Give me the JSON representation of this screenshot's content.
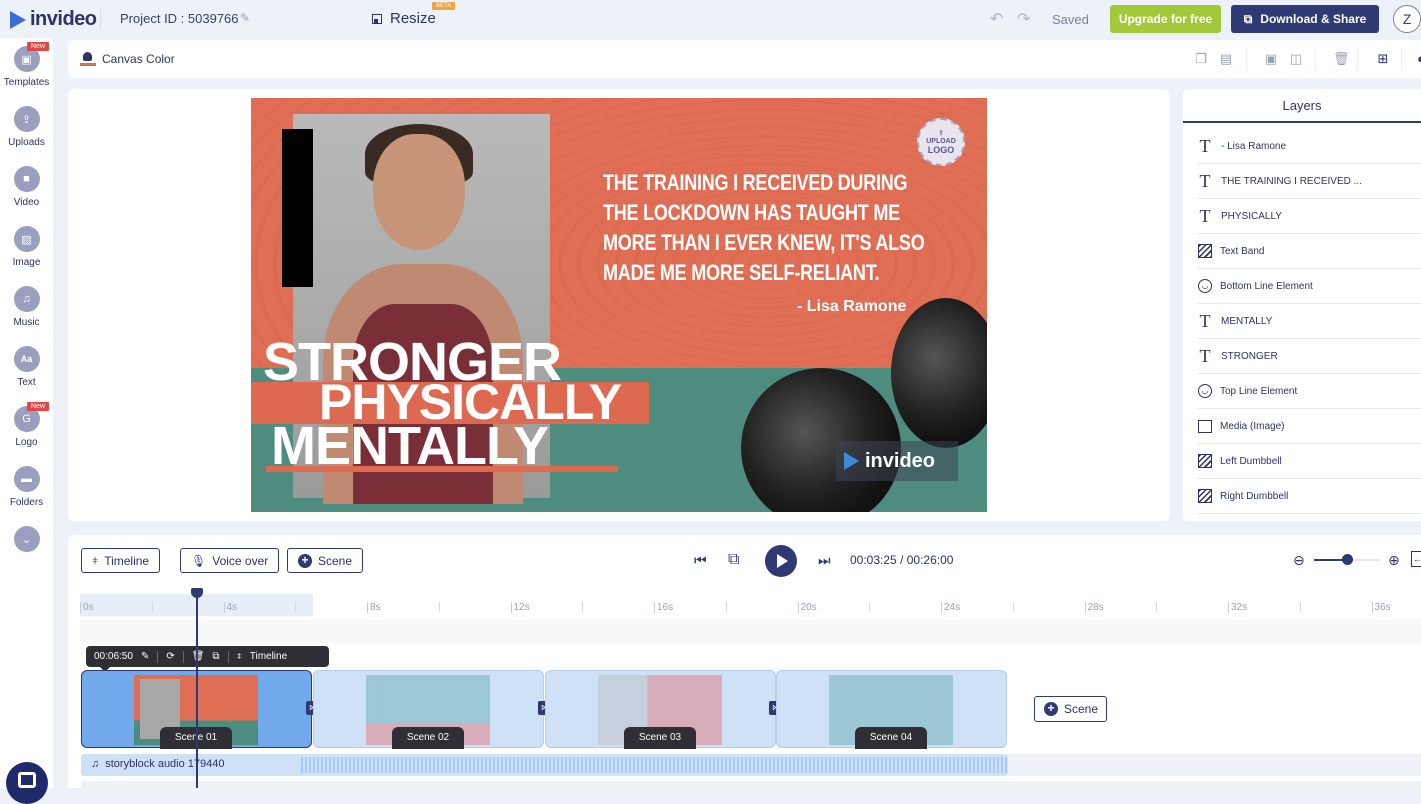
{
  "header": {
    "brand": "invideo",
    "project_id": "Project ID : 5039766",
    "resize_label": "Resize",
    "beta_badge": "BETA",
    "status": "Saved",
    "upgrade_label": "Upgrade for free",
    "download_label": "Download & Share",
    "avatar_initial": "Z"
  },
  "sidebar": {
    "items": [
      {
        "label": "Templates",
        "icon": "templates-icon",
        "badge": "New"
      },
      {
        "label": "Uploads",
        "icon": "upload-icon",
        "badge": ""
      },
      {
        "label": "Video",
        "icon": "video-icon",
        "badge": ""
      },
      {
        "label": "Image",
        "icon": "image-icon",
        "badge": ""
      },
      {
        "label": "Music",
        "icon": "music-icon",
        "badge": ""
      },
      {
        "label": "Text",
        "icon": "text-icon",
        "badge": ""
      },
      {
        "label": "Logo",
        "icon": "logo-icon",
        "badge": "New"
      },
      {
        "label": "Folders",
        "icon": "folder-icon",
        "badge": ""
      }
    ]
  },
  "canvas_toolbar": {
    "canvas_color_label": "Canvas Color",
    "canvas_color": "#e06a4a"
  },
  "design": {
    "quote_lines": [
      "THE TRAINING I RECEIVED DURING",
      "THE LOCKDOWN HAS TAUGHT ME",
      "MORE THAN I EVER KNEW, IT'S ALSO",
      "MADE ME MORE SELF-RELIANT."
    ],
    "author": "- Lisa Ramone",
    "headline_1": "STRONGER",
    "headline_2": "PHYSICALLY",
    "headline_3": "MENTALLY",
    "upload_logo_line1": "UPLOAD",
    "upload_logo_line2": "LOGO",
    "watermark": "invideo",
    "colors": {
      "primary": "#e06e55",
      "teal": "#4e8c80"
    }
  },
  "layers": {
    "title": "Layers",
    "items": [
      {
        "label": "- Lisa Ramone",
        "type": "text"
      },
      {
        "label": "THE TRAINING I RECEIVED ...",
        "type": "text"
      },
      {
        "label": "PHYSICALLY",
        "type": "text"
      },
      {
        "label": "Text Band",
        "type": "shape"
      },
      {
        "label": "Bottom Line Element",
        "type": "sticker"
      },
      {
        "label": "MENTALLY",
        "type": "text"
      },
      {
        "label": "STRONGER",
        "type": "text"
      },
      {
        "label": "Top Line Element",
        "type": "sticker"
      },
      {
        "label": "Media (Image)",
        "type": "image"
      },
      {
        "label": "Left Dumbbell",
        "type": "shape"
      },
      {
        "label": "Right Dumbbell",
        "type": "shape"
      }
    ]
  },
  "timeline": {
    "buttons": {
      "timeline": "Timeline",
      "voice_over": "Voice over",
      "scene": "Scene"
    },
    "current_time": "00:03:25",
    "total_time": "00:26:00",
    "time_separator": "/",
    "zoom_level_fraction": 0.5,
    "ruler_ticks": [
      "0s",
      "4s",
      "8s",
      "12s",
      "16s",
      "20s",
      "24s",
      "28s",
      "32s",
      "36s"
    ],
    "scene_toolbar": {
      "duration": "00:06:50",
      "timeline_label": "Timeline"
    },
    "scenes": [
      {
        "label": "Scene 01",
        "active": true
      },
      {
        "label": "Scene 02",
        "active": false
      },
      {
        "label": "Scene 03",
        "active": false
      },
      {
        "label": "Scene 04",
        "active": false
      }
    ],
    "add_scene_label": "Scene",
    "audio_track": "storyblock audio 179440"
  }
}
